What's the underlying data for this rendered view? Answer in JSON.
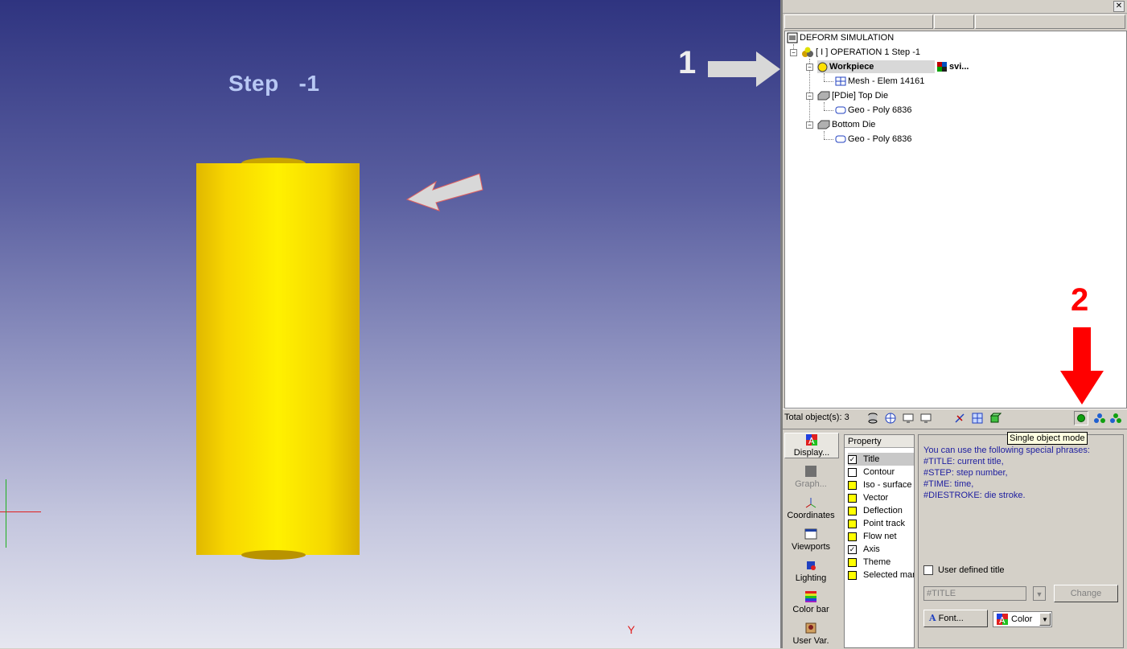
{
  "viewport": {
    "step_title": "Step   -1",
    "axis_y_label": "Y",
    "annotation_1": "1",
    "annotation_2": "2"
  },
  "panel": {
    "close_glyph": "✕",
    "tree": {
      "root": "DEFORM SIMULATION",
      "operation": "[ I ]  OPERATION 1  Step -1",
      "workpiece": "Workpiece",
      "workpiece_material": "svi...",
      "workpiece_mesh": "Mesh - Elem 14161",
      "top_die": "[PDie] Top Die",
      "top_die_geo": "Geo - Poly 6836",
      "bottom_die": "Bottom Die",
      "bottom_die_geo": "Geo - Poly 6836"
    },
    "status": {
      "total_objects": "Total object(s): 3",
      "tooltip": "Single object mode"
    },
    "nav": {
      "display": "Display...",
      "graph": "Graph...",
      "coordinates": "Coordinates",
      "viewports": "Viewports",
      "lighting": "Lighting",
      "color_bar": "Color bar",
      "user_var": "User Var."
    },
    "properties": {
      "header": "Property",
      "items": [
        {
          "label": "Title",
          "checked": true
        },
        {
          "label": "Contour",
          "checked": false
        },
        {
          "label": "Iso - surface",
          "checked": false
        },
        {
          "label": "Vector",
          "checked": false
        },
        {
          "label": "Deflection",
          "checked": false
        },
        {
          "label": "Point track",
          "checked": false
        },
        {
          "label": "Flow net",
          "checked": false
        },
        {
          "label": "Axis",
          "checked": true
        },
        {
          "label": "Theme",
          "checked": false
        },
        {
          "label": "Selected mar",
          "checked": false
        }
      ]
    },
    "details": {
      "help_line1": "You can use the following special phrases:",
      "help_line2": "#TITLE: current title,",
      "help_line3": "#STEP: step number,",
      "help_line4": "#TIME: time,",
      "help_line5": "#DIESTROKE: die stroke.",
      "user_defined_title": "User defined title",
      "title_value": "#TITLE",
      "change_button": "Change",
      "font_button": "Font...",
      "color_select": "Color"
    },
    "colors": {
      "workpiece": "#f7e000",
      "annotation_red": "#ff0000",
      "annotation_gray": "#d8d8d8"
    }
  }
}
